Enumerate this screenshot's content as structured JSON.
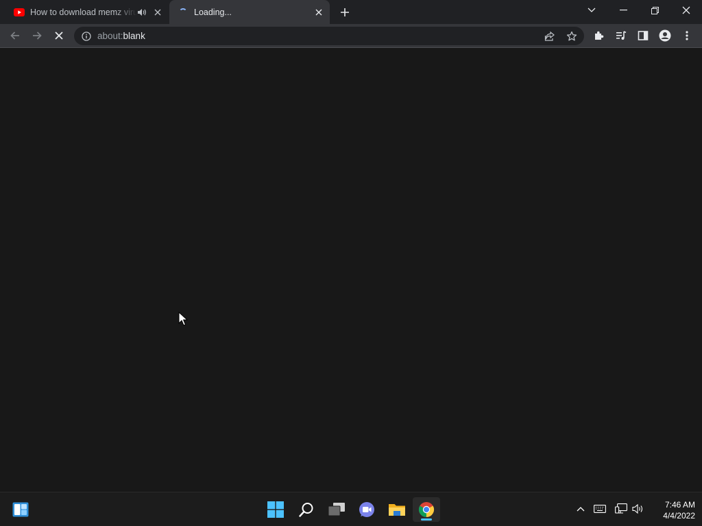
{
  "browser": {
    "tabs": [
      {
        "title": "How to download memz virus",
        "favicon": "youtube-icon",
        "audio": true,
        "active": false
      },
      {
        "title": "Loading...",
        "favicon": "loading-spinner-icon",
        "active": true
      }
    ],
    "address": {
      "prefix": "about:",
      "host": "blank"
    },
    "toolbar_icons": [
      "back-icon",
      "forward-icon",
      "stop-icon",
      "share-icon",
      "bookmark-star-icon",
      "extensions-icon",
      "media-control-icon",
      "side-panel-icon",
      "profile-icon",
      "menu-icon"
    ]
  },
  "taskbar": {
    "apps": [
      "widgets-icon",
      "start-icon",
      "search-icon",
      "task-view-icon",
      "teams-chat-icon",
      "file-explorer-icon",
      "chrome-icon"
    ],
    "clock": {
      "time": "7:46 AM",
      "date": "4/4/2022"
    }
  },
  "colors": {
    "accent": "#4cc2ff",
    "youtube_red": "#ff0000",
    "page_background": "#181818"
  }
}
